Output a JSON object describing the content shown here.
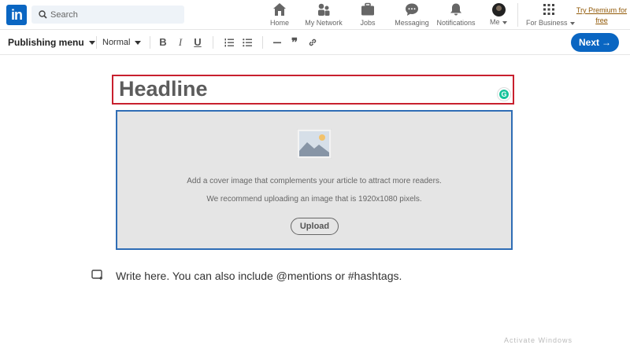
{
  "search": {
    "placeholder": "Search"
  },
  "nav": {
    "home": "Home",
    "network": "My Network",
    "jobs": "Jobs",
    "messaging": "Messaging",
    "notifications": "Notifications",
    "me": "Me",
    "business": "For Business",
    "premium_line1": "Try Premium for",
    "premium_line2": "free"
  },
  "toolbar": {
    "publishing_menu": "Publishing menu",
    "style": "Normal",
    "bold": "B",
    "italic": "I",
    "underline": "U",
    "quote": "❞",
    "next": "Next"
  },
  "editor": {
    "headline": "Headline",
    "cover_text1": "Add a cover image that complements your article to attract more readers.",
    "cover_text2": "We recommend uploading an image that is 1920x1080 pixels.",
    "upload": "Upload",
    "write_placeholder": "Write here. You can also include @mentions or #hashtags."
  },
  "logo_text": "in",
  "grammarly": "G",
  "watermark": "Activate Windows",
  "colors": {
    "brand": "#0a66c2",
    "headline_outline": "#c8202e",
    "cover_outline": "#2f6db5",
    "premium": "#915907"
  }
}
